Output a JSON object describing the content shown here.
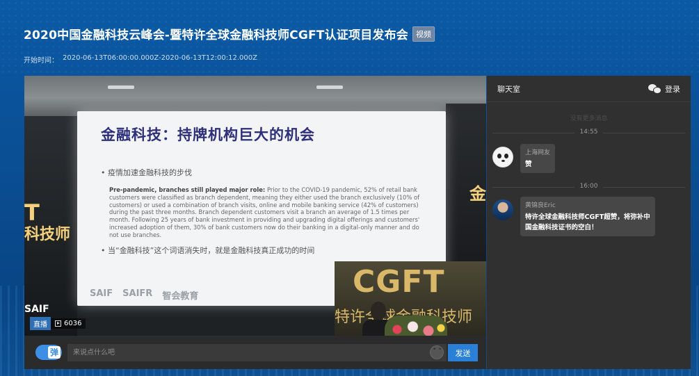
{
  "header": {
    "title": "2020中国金融科技云峰会-暨特许全球金融科技师CGFT认证项目发布会",
    "tag": "视频",
    "time_label": "开始时间：",
    "time_range": "2020-06-13T06:00:00.000Z-2020-06-13T12:00:12.000Z"
  },
  "player": {
    "slide": {
      "title": "金融科技：持牌机构巨大的机会",
      "bullet1": "• 疫情加速金融科技的步伐",
      "para_bold": "Pre-pandemic, branches still played major role:",
      "para_text": "Prior to the COVID-19 pandemic, 52% of retail bank customers were classified as branch dependent, meaning they either used the branch exclusively (10% of customers) or used a combination of branch visits, online and mobile banking service (42% of customers) during the past three months. Branch dependent customers visit a branch an average of 1.5 times per month. Following 25 years of bank investment in providing and upgrading digital offerings and customers' increased adoption of them, 30% of bank customers now do their banking in a digital-only manner and do not use branches.",
      "bullet2": "• 当“金融科技”这个词语消失时，就是金融科技真正成功的时间",
      "logos": [
        "SAIF",
        "SAIFR",
        "智会教育"
      ]
    },
    "wall_left_big": "T",
    "wall_left_text": "科技师",
    "wall_left_logo": "SAIF",
    "wall_right_text": "金",
    "pip_title": "CGFT",
    "pip_sub": "特许全球金融科技师",
    "live_label": "直播",
    "viewer_count": "6036"
  },
  "bottombar": {
    "danmu_label": "弹",
    "input_placeholder": "来说点什么吧",
    "send_label": "发送"
  },
  "chat": {
    "title": "聊天室",
    "login_label": "登录",
    "load_more": "没有更多消息",
    "messages": [
      {
        "time": "14:55",
        "name": "上海网友",
        "text": "赞"
      },
      {
        "time": "16:00",
        "name": "黄锦良Eric",
        "text": "特许全球金融科技师CGFT超赞，将弥补中国金融科技证书的空白！"
      }
    ]
  }
}
